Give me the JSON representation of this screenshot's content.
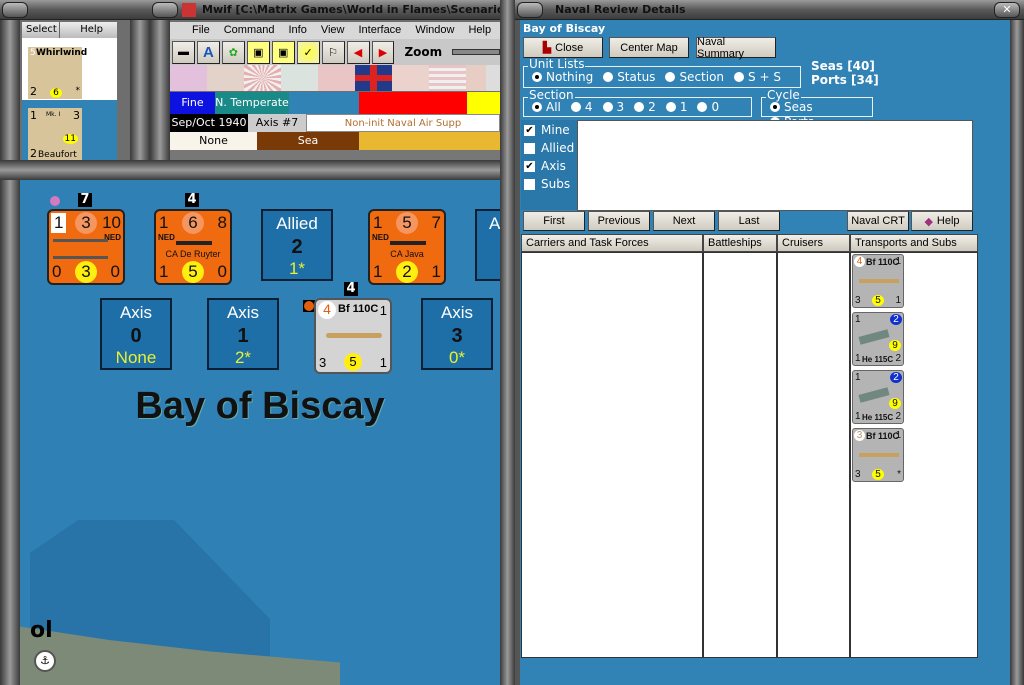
{
  "left_window": {
    "menu": [
      "Select",
      "Help"
    ],
    "units": [
      {
        "name": "Whirlwind",
        "top_left": "5",
        "bottom_left": "2",
        "value": "6",
        "star": "*"
      },
      {
        "name": "Beaufort",
        "mark": "Mk. I",
        "top_left": "1",
        "top_right": "3",
        "bottom_left": "2",
        "value": "11",
        "star": "*"
      }
    ]
  },
  "main_window": {
    "title": "Mwif [C:\\Matrix Games\\World in Flames\\Scenario",
    "menu": [
      "File",
      "Command",
      "Info",
      "View",
      "Interface",
      "Window",
      "Help"
    ],
    "zoom_label": "Zoom",
    "weather": "Fine",
    "zone": "N. Temperate",
    "date": "Sep/Oct 1940",
    "impulse": "Axis #7",
    "phase": "Non-init Naval Air Supp",
    "row3a": "None",
    "row3b": "Sea"
  },
  "map": {
    "sea_name": "Bay of Biscay",
    "partial_label": "ol",
    "ships": [
      {
        "stack": "7",
        "tl": "1",
        "tm": "3",
        "tr": "10",
        "nat": "NED",
        "bl": "0",
        "bm": "3",
        "br": "0",
        "name": ""
      },
      {
        "stack": "4",
        "tl": "1",
        "tm": "6",
        "tr": "8",
        "nat": "NED",
        "bl": "1",
        "bm": "5",
        "br": "0",
        "name": "CA De Ruyter"
      },
      {
        "stack": "",
        "tl": "1",
        "tm": "5",
        "tr": "7",
        "nat": "NED",
        "bl": "1",
        "bm": "2",
        "br": "1",
        "name": "CA Java"
      }
    ],
    "boxes": [
      {
        "side": "Allied",
        "count": "2",
        "sub": "1*"
      },
      {
        "side": "Axis",
        "count": "0",
        "sub": "None"
      },
      {
        "side": "Axis",
        "count": "1",
        "sub": "2*"
      },
      {
        "side": "Axis",
        "count": "3",
        "sub": "0*"
      },
      {
        "side": "A"
      }
    ],
    "air_unit": {
      "stack": "4",
      "tl": "4",
      "name": "Bf 110C",
      "tr": "1",
      "bl": "3",
      "bm": "5",
      "br": "1"
    }
  },
  "naval_review": {
    "title": "Naval Review Details",
    "area": "Bay of Biscay",
    "buttons": {
      "close": "Close",
      "center": "Center Map",
      "summary": "Naval Summary",
      "first": "First",
      "previous": "Previous",
      "next": "Next",
      "last": "Last",
      "crt": "Naval CRT",
      "help": "Help"
    },
    "unit_lists": {
      "label": "Unit Lists",
      "options": [
        "Nothing",
        "Status",
        "Section",
        "S + S"
      ],
      "selected": 0
    },
    "seas": "Seas [40]",
    "ports": "Ports [34]",
    "section": {
      "label": "Section",
      "options": [
        "All",
        "4",
        "3",
        "2",
        "1",
        "0"
      ],
      "selected": 0
    },
    "cycle": {
      "label": "Cycle",
      "options": [
        "Seas",
        "Ports"
      ],
      "selected": 0
    },
    "filters": [
      {
        "label": "Mine",
        "checked": true
      },
      {
        "label": "Allied",
        "checked": false
      },
      {
        "label": "Axis",
        "checked": true
      },
      {
        "label": "Subs",
        "checked": false
      }
    ],
    "columns": [
      "Carriers and Task Forces",
      "Battleships",
      "Cruisers",
      "Transports and Subs"
    ],
    "transports": [
      {
        "tl": "4",
        "name": "Bf 110C",
        "tr": "1",
        "bl": "3",
        "bm": "5",
        "br": "1"
      },
      {
        "tl": "1",
        "badge": "2",
        "bm": "9",
        "bl": "1",
        "name": "He 115C",
        "br": "2"
      },
      {
        "tl": "1",
        "badge": "2",
        "bm": "9",
        "bl": "1",
        "name": "He 115C",
        "br": "2"
      },
      {
        "tl": "3",
        "name": "Bf 110C",
        "tr": "1",
        "bl": "3",
        "bm": "5",
        "br": "*"
      }
    ]
  },
  "colors": {
    "sea": "#2f80b5",
    "counter_orange": "#f06a10",
    "panel": "#3182b5"
  }
}
